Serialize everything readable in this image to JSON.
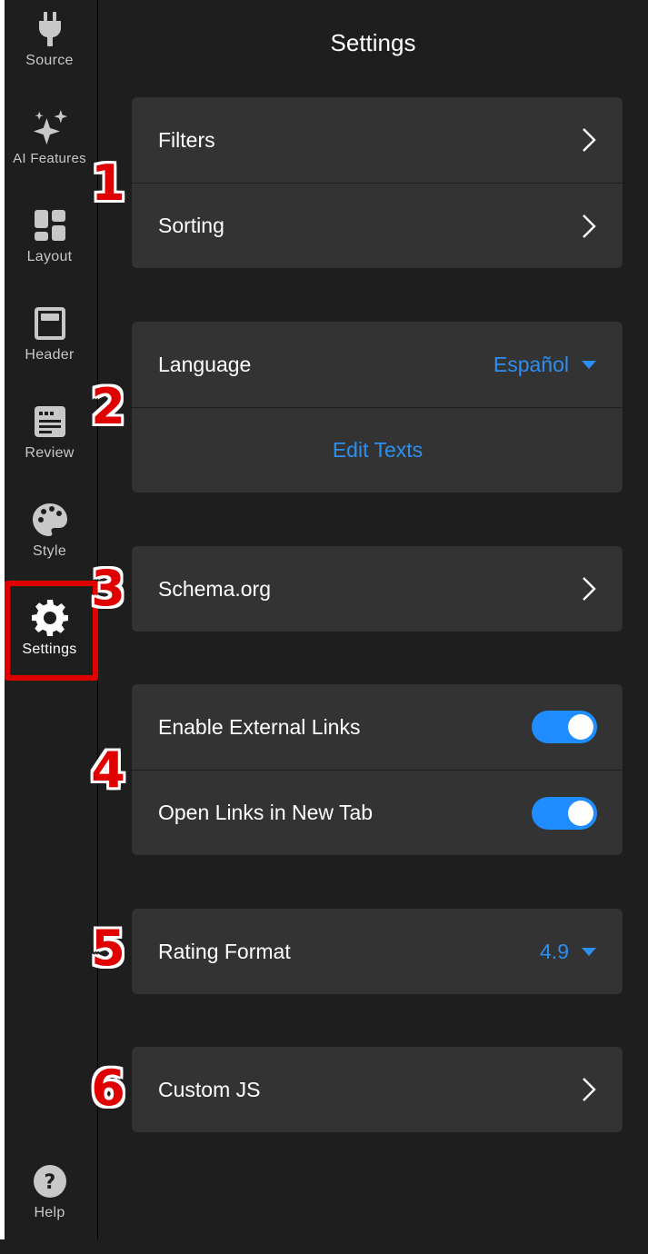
{
  "page_title": "Settings",
  "sidebar": {
    "items": [
      {
        "label": "Source",
        "icon": "plug-icon"
      },
      {
        "label": "AI Features",
        "icon": "sparkles-icon"
      },
      {
        "label": "Layout",
        "icon": "layout-grid-icon"
      },
      {
        "label": "Header",
        "icon": "header-window-icon"
      },
      {
        "label": "Review",
        "icon": "review-card-icon"
      },
      {
        "label": "Style",
        "icon": "palette-icon"
      },
      {
        "label": "Settings",
        "icon": "gear-icon"
      }
    ],
    "help": {
      "label": "Help",
      "icon": "help-icon"
    },
    "active_color": "#e00000"
  },
  "groups": {
    "filters_sorting": {
      "filters_label": "Filters",
      "sorting_label": "Sorting"
    },
    "language": {
      "label": "Language",
      "value": "Español",
      "edit_texts_label": "Edit Texts"
    },
    "schema": {
      "label": "Schema.org"
    },
    "links": {
      "external_links_label": "Enable External Links",
      "external_links_enabled": true,
      "new_tab_label": "Open Links in New Tab",
      "new_tab_enabled": true
    },
    "rating": {
      "label": "Rating Format",
      "value": "4.9"
    },
    "custom_js": {
      "label": "Custom JS"
    }
  },
  "badges": [
    "1",
    "2",
    "3",
    "4",
    "5",
    "6"
  ],
  "colors": {
    "accent": "#2d8ff0",
    "toggle_on": "#1f8cff",
    "card": "#333333",
    "background": "#1e1e1e"
  }
}
